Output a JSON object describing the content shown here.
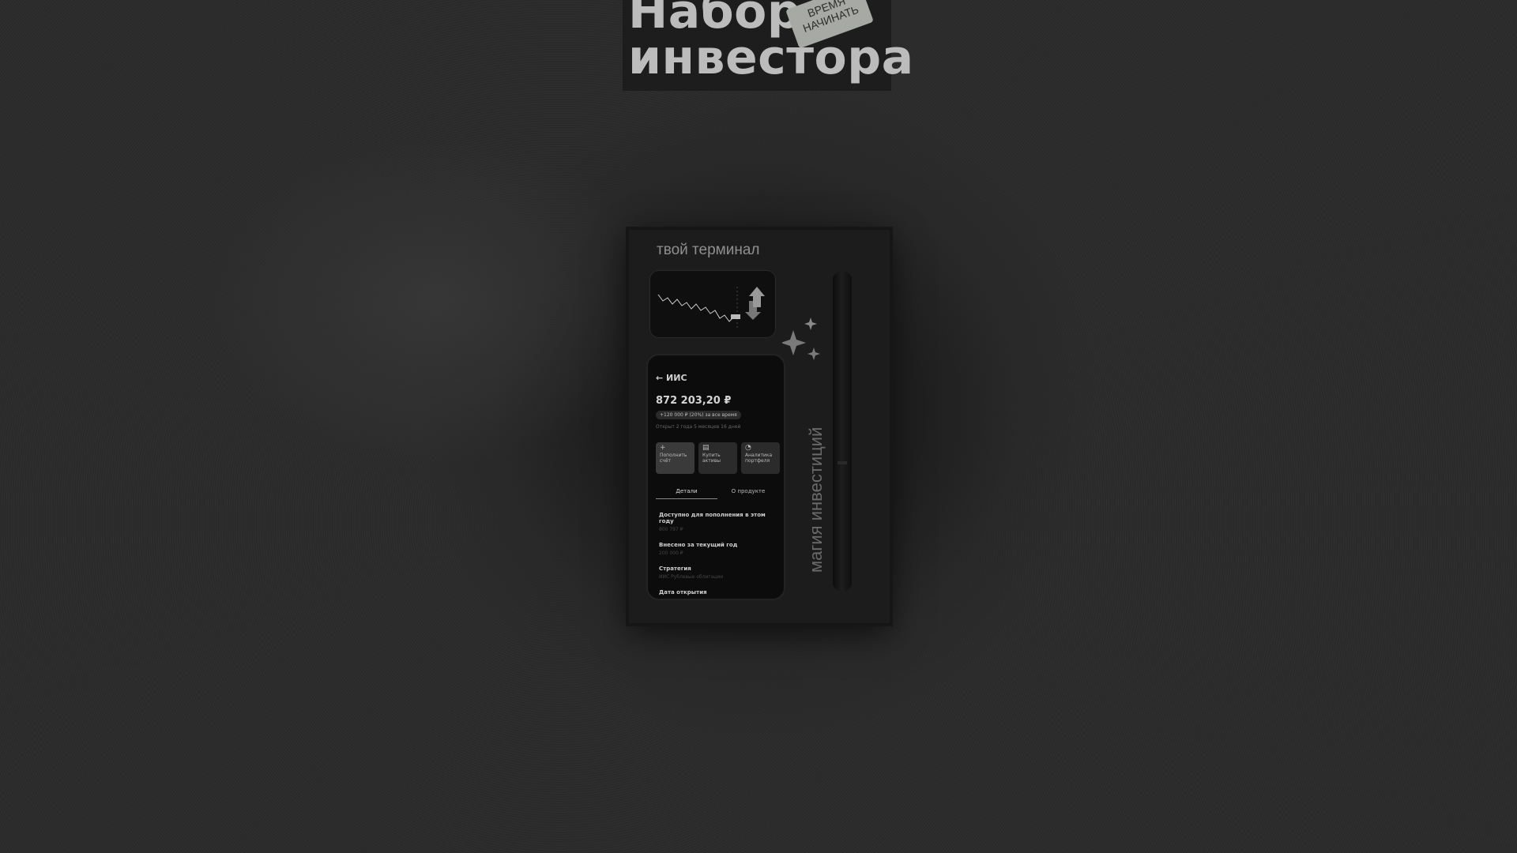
{
  "header": {
    "title_line1": "Набор",
    "title_line2": "инвестора",
    "sticker_line1": "ВРЕМЯ",
    "sticker_line2": "НАЧИНАТЬ"
  },
  "box": {
    "label": "твой терминал",
    "side_text": "магия инвестиций"
  },
  "phone": {
    "header": "← ИИС",
    "balance": "872 203,20 ₽",
    "gain_chip": "+120 000 ₽ (20%) за все время",
    "opened": "Открыт 2 года 5 месяцев 16 дней",
    "actions": [
      {
        "label": "Пополнить счёт",
        "icon": "plus-icon"
      },
      {
        "label": "Купить активы",
        "icon": "wallet-icon"
      },
      {
        "label": "Аналитика портфеля",
        "icon": "pie-chart-icon"
      }
    ],
    "tabs": [
      "Детали",
      "О продукте"
    ],
    "rows": [
      {
        "label": "Доступно для пополнения в этом году",
        "value": "800 797 ₽"
      },
      {
        "label": "Внесено за текущий год",
        "value": "200 000 ₽"
      },
      {
        "label": "Стратегия",
        "value": "ИИС Рублевые облигации"
      },
      {
        "label": "Дата открытия",
        "value": ""
      }
    ]
  }
}
